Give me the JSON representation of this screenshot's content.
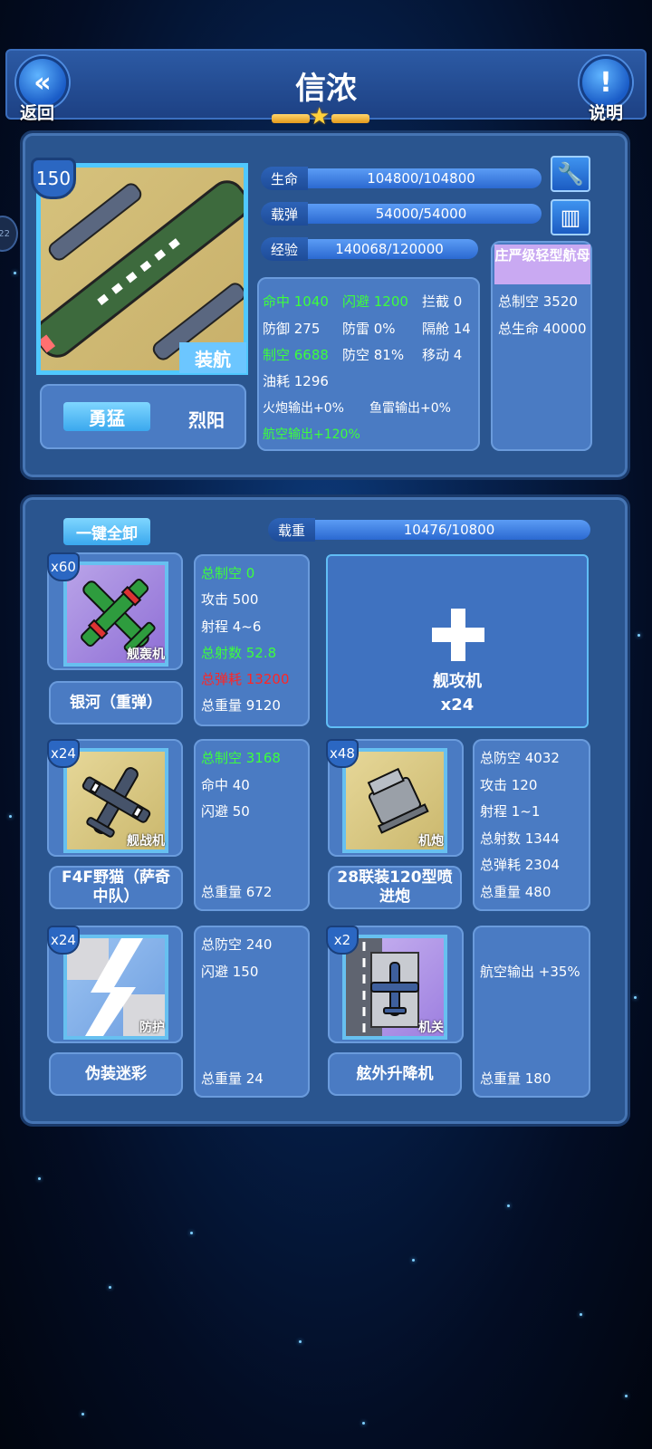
{
  "header": {
    "back_label": "返回",
    "back_icon": "double-chevron-left-icon",
    "title": "信浓",
    "help_label": "说明",
    "help_icon": "exclamation-icon"
  },
  "ship": {
    "level": "150",
    "type_tag": "装航",
    "hp": {
      "label": "生命",
      "value": "104800/104800",
      "fraction": 1.0
    },
    "ammo": {
      "label": "载弹",
      "value": "54000/54000",
      "fraction": 1.0
    },
    "exp": {
      "label": "经验",
      "value": "140068/120000",
      "fraction": 1.0
    },
    "stats": [
      [
        "命中 1040",
        "闪避 1200",
        "拦截 0"
      ],
      [
        "防御 275",
        "防雷 0%",
        "隔舱 14"
      ],
      [
        "制空 6688",
        "防空 81%",
        "移动 4"
      ],
      [
        "油耗 1296"
      ],
      [
        "火炮输出+0%",
        "鱼雷输出+0%"
      ],
      [
        "航空输出+120%"
      ]
    ],
    "skill_active": "勇猛",
    "skill_other": "烈阳",
    "class": {
      "name": "庄严级轻型航母",
      "total_air": "总制空 3520",
      "total_hp": "总生命 40000"
    }
  },
  "loadout": {
    "unequip_all": "一键全卸",
    "weight": {
      "label": "载重",
      "value": "10476/10800",
      "fraction": 0.97
    },
    "slots": [
      {
        "count": "x60",
        "tag": "舰轰机",
        "name": "银河（重弹）",
        "stats": [
          "总制空 0",
          "攻击 500",
          "射程 4~6",
          "总射数 52.8",
          "总弹耗 13200"
        ],
        "weight": "总重量 9120"
      },
      {
        "count": "x24",
        "tag": "舰战机",
        "name": "F4F野猫（萨奇中队）",
        "stats": [
          "总制空 3168",
          "命中 40",
          "闪避 50"
        ],
        "weight": "总重量 672"
      },
      {
        "count": "x48",
        "tag": "机炮",
        "name": "28联装120型喷进炮",
        "stats": [
          "总防空 4032",
          "攻击 120",
          "射程 1~1",
          "总射数 1344",
          "总弹耗 2304"
        ],
        "weight": "总重量 480"
      },
      {
        "count": "x24",
        "tag": "防护",
        "name": "伪装迷彩",
        "stats": [
          "总防空 240",
          "闪避 150"
        ],
        "weight": "总重量 24"
      },
      {
        "count": "x2",
        "tag": "机关",
        "name": "舷外升降机",
        "stats": [
          "航空输出 +35%"
        ],
        "weight": "总重量 180"
      }
    ],
    "empty_slot": {
      "label": "舰攻机",
      "count": "x24"
    }
  },
  "side_badge": "22",
  "colors": {
    "green_stat": "#3cff3c",
    "red_stat": "#ff2626",
    "panel": "#2a558f",
    "accent": "#50c8ff"
  }
}
